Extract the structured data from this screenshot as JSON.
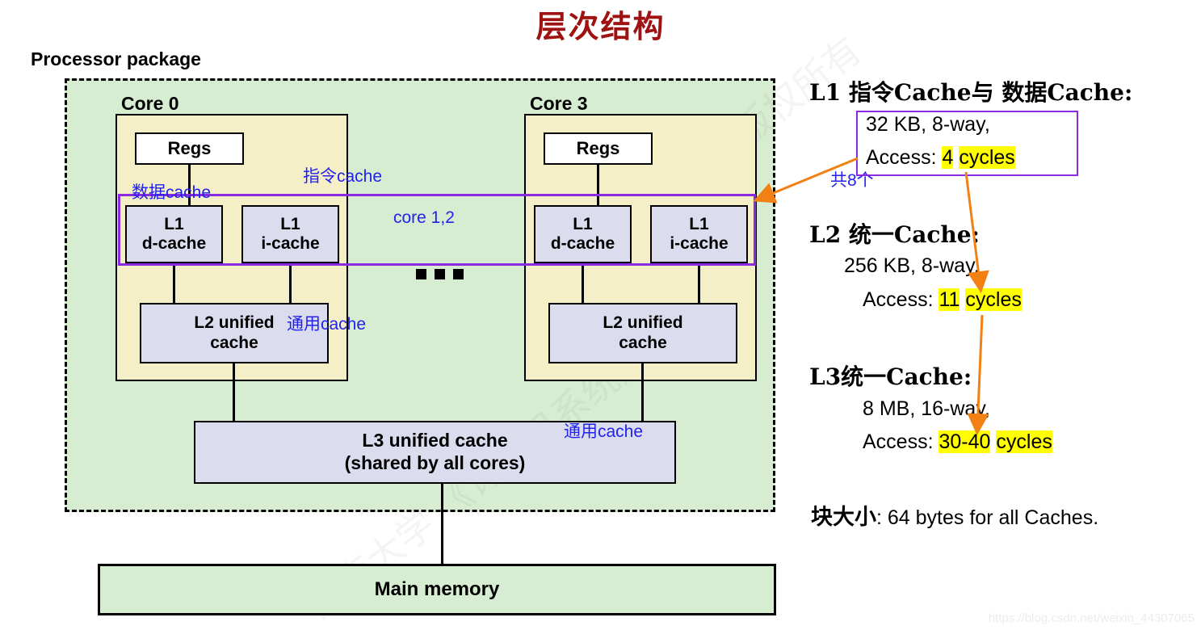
{
  "title": "层次结构",
  "package": {
    "label": "Processor package"
  },
  "cores": [
    {
      "label": "Core 0",
      "regs": "Regs",
      "l1d_line1": "L1",
      "l1d_line2": "d-cache",
      "l1i_line1": "L1",
      "l1i_line2": "i-cache",
      "l2_line1": "L2 unified",
      "l2_line2": "cache"
    },
    {
      "label": "Core 3",
      "regs": "Regs",
      "l1d_line1": "L1",
      "l1d_line2": "d-cache",
      "l1i_line1": "L1",
      "l1i_line2": "i-cache",
      "l2_line1": "L2 unified",
      "l2_line2": "cache"
    }
  ],
  "l3": {
    "line1": "L3 unified cache",
    "line2": "(shared by all cores)"
  },
  "main_memory": "Main memory",
  "annotations": {
    "data_cache": "数据cache",
    "instr_cache": "指令cache",
    "core_12": "core 1,2",
    "l2_generic": "通用cache",
    "l3_generic": "通用cache",
    "total8": "共8个"
  },
  "right_panel": {
    "l1": {
      "heading": "L1 指令Cache与 数据Cache:",
      "size": "32 KB,  8-way,",
      "access_label": "Access: ",
      "access_value": "4",
      "access_unit": "cycles"
    },
    "l2": {
      "heading": "L2 统一Cache:",
      "size": "256 KB, 8-way,",
      "access_label": "Access: ",
      "access_value": "11",
      "access_unit": "cycles"
    },
    "l3": {
      "heading": "L3统一Cache:",
      "size": "8 MB, 16-way,",
      "access_label": "Access: ",
      "access_value": "30-40",
      "access_unit": "cycles"
    },
    "block_size": {
      "label": "块大小",
      "value": ": 64 bytes for all Caches."
    }
  },
  "watermark": {
    "url": "https://blog.csdn.net/weixin_44307065",
    "diag1": "课程组版权所有",
    "diag2": "湖南大学 《计算机系统》"
  },
  "colors": {
    "title": "#9e1212",
    "package_bg": "#d7edd2",
    "core_bg": "#f4efc6",
    "cache_bg": "#dcdcef",
    "annotation_blue": "#2222ee",
    "purple": "#8a2be2",
    "arrow_orange": "#f28013",
    "highlight": "#ffff00"
  }
}
